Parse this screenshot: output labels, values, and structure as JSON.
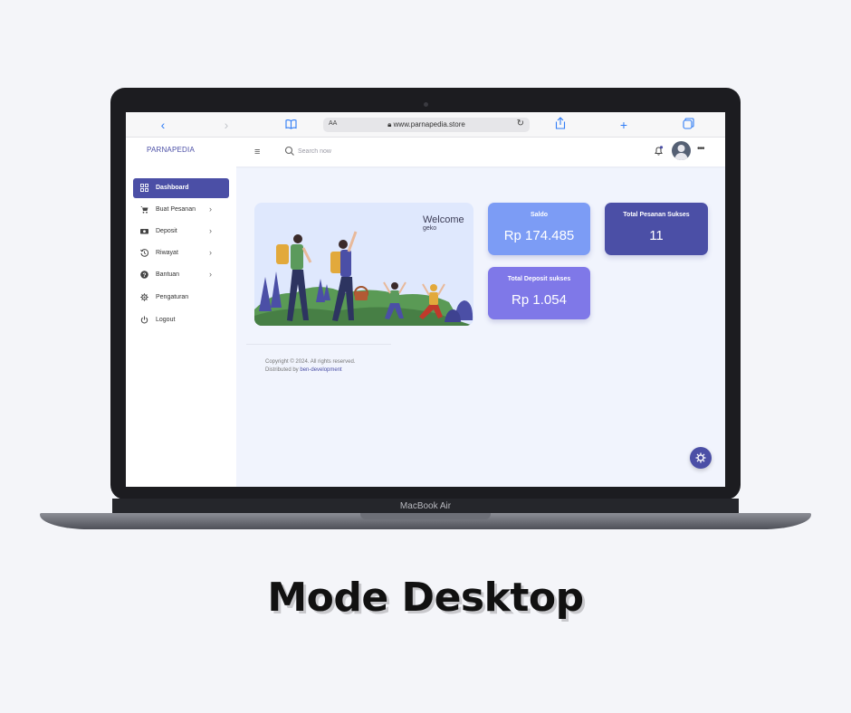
{
  "device": {
    "brand_label": "MacBook Air"
  },
  "browser": {
    "url_size_label": "AA",
    "url": "www.parnapedia.store"
  },
  "app": {
    "logo": "PARNAPEDIA",
    "search_placeholder": "Search now"
  },
  "sidebar": {
    "items": [
      {
        "label": "Dashboard",
        "icon": "grid-icon",
        "active": true,
        "chevron": false
      },
      {
        "label": "Buat Pesanan",
        "icon": "cart-icon",
        "active": false,
        "chevron": true
      },
      {
        "label": "Deposit",
        "icon": "money-icon",
        "active": false,
        "chevron": true
      },
      {
        "label": "Riwayat",
        "icon": "history-icon",
        "active": false,
        "chevron": true
      },
      {
        "label": "Bantuan",
        "icon": "help-icon",
        "active": false,
        "chevron": true
      },
      {
        "label": "Pengaturan",
        "icon": "gear-icon",
        "active": false,
        "chevron": false
      },
      {
        "label": "Logout",
        "icon": "power-icon",
        "active": false,
        "chevron": false
      }
    ]
  },
  "welcome": {
    "title": "Welcome",
    "user": "geko"
  },
  "stats": {
    "saldo": {
      "label": "Saldo",
      "value": "Rp 174.485",
      "color": "#7c9cf5"
    },
    "total_pesanan": {
      "label": "Total Pesanan Sukses",
      "value": "11",
      "color": "#4b4fa6"
    },
    "total_deposit": {
      "label": "Total Deposit sukses",
      "value": "Rp 1.054",
      "color": "#7f78e8"
    }
  },
  "footer": {
    "copyright": "Copyright © 2024. All rights reserved.",
    "distributed_prefix": "Distributed by ",
    "distributed_link": "ben-development"
  },
  "caption": "Mode Desktop"
}
